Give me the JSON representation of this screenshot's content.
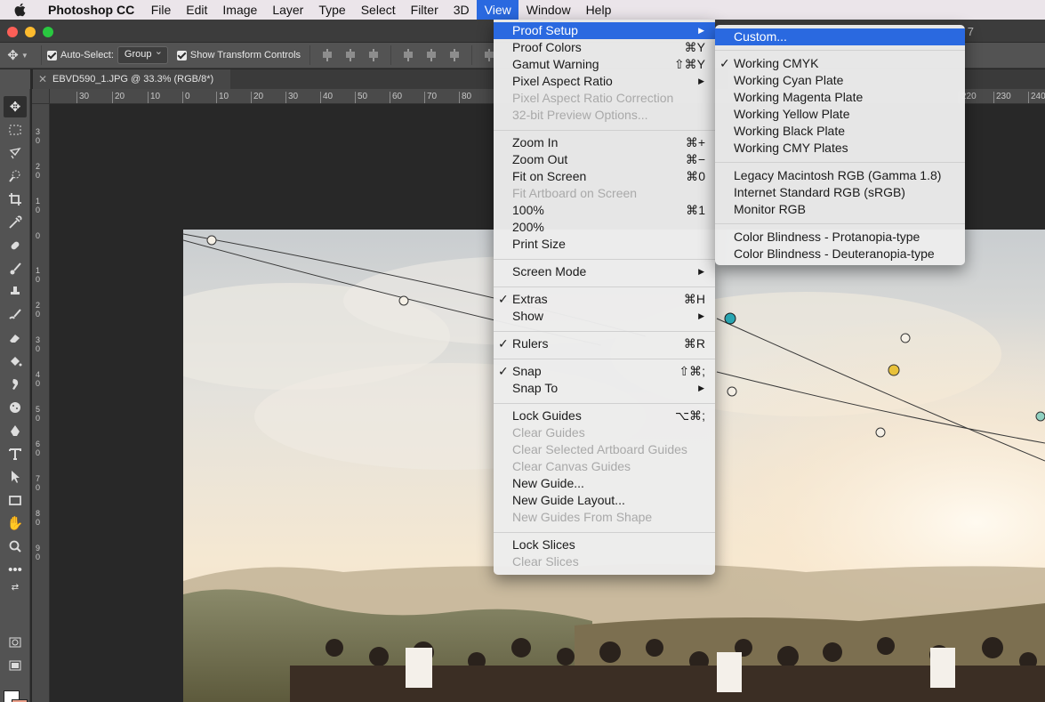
{
  "menubar": {
    "app_name": "Photoshop CC",
    "items": [
      "File",
      "Edit",
      "Image",
      "Layer",
      "Type",
      "Select",
      "Filter",
      "3D",
      "View",
      "Window",
      "Help"
    ],
    "active": "View"
  },
  "title_tail": "7",
  "options": {
    "auto_select_label": "Auto-Select:",
    "auto_select_value": "Group",
    "show_transform_label": "Show Transform Controls"
  },
  "document_tab": "EBVD590_1.JPG @ 33.3% (RGB/8*)",
  "ruler": {
    "top": [
      "30",
      "20",
      "10",
      "0",
      "10",
      "20",
      "30",
      "40",
      "50",
      "60",
      "70",
      "80",
      "220",
      "230",
      "240"
    ],
    "left": [
      "3",
      "0",
      "2",
      "0",
      "1",
      "0",
      "0",
      "1",
      "0",
      "2",
      "0",
      "3",
      "0",
      "4",
      "0",
      "5",
      "0",
      "6",
      "0",
      "7",
      "0",
      "8",
      "0",
      "9",
      "0"
    ]
  },
  "view_menu": {
    "items": [
      {
        "label": "Proof Setup",
        "shortcut": "",
        "submenu": true,
        "highlighted": true
      },
      {
        "label": "Proof Colors",
        "shortcut": "⌘Y"
      },
      {
        "label": "Gamut Warning",
        "shortcut": "⇧⌘Y"
      },
      {
        "label": "Pixel Aspect Ratio",
        "shortcut": "",
        "submenu": true
      },
      {
        "label": "Pixel Aspect Ratio Correction",
        "disabled": true
      },
      {
        "label": "32-bit Preview Options...",
        "disabled": true
      },
      {
        "label": "Zoom In",
        "shortcut": "⌘+"
      },
      {
        "label": "Zoom Out",
        "shortcut": "⌘−"
      },
      {
        "label": "Fit on Screen",
        "shortcut": "⌘0"
      },
      {
        "label": "Fit Artboard on Screen",
        "disabled": true
      },
      {
        "label": "100%",
        "shortcut": "⌘1"
      },
      {
        "label": "200%",
        "shortcut": ""
      },
      {
        "label": "Print Size",
        "shortcut": ""
      },
      {
        "label": "Screen Mode",
        "submenu": true
      },
      {
        "label": "Extras",
        "shortcut": "⌘H",
        "checked": true
      },
      {
        "label": "Show",
        "submenu": true
      },
      {
        "label": "Rulers",
        "shortcut": "⌘R",
        "checked": true
      },
      {
        "label": "Snap",
        "shortcut": "⇧⌘;",
        "checked": true
      },
      {
        "label": "Snap To",
        "submenu": true
      },
      {
        "label": "Lock Guides",
        "shortcut": "⌥⌘;"
      },
      {
        "label": "Clear Guides",
        "disabled": true
      },
      {
        "label": "Clear Selected Artboard Guides",
        "disabled": true
      },
      {
        "label": "Clear Canvas Guides",
        "disabled": true
      },
      {
        "label": "New Guide..."
      },
      {
        "label": "New Guide Layout..."
      },
      {
        "label": "New Guides From Shape",
        "disabled": true
      },
      {
        "label": "Lock Slices"
      },
      {
        "label": "Clear Slices",
        "disabled": true
      }
    ]
  },
  "proof_menu": {
    "items": [
      {
        "label": "Custom...",
        "highlighted": true
      },
      {
        "label": "Working CMYK",
        "checked": true
      },
      {
        "label": "Working Cyan Plate"
      },
      {
        "label": "Working Magenta Plate"
      },
      {
        "label": "Working Yellow Plate"
      },
      {
        "label": "Working Black Plate"
      },
      {
        "label": "Working CMY Plates"
      },
      {
        "label": "Legacy Macintosh RGB (Gamma 1.8)"
      },
      {
        "label": "Internet Standard RGB (sRGB)"
      },
      {
        "label": "Monitor RGB"
      },
      {
        "label": "Color Blindness - Protanopia-type"
      },
      {
        "label": "Color Blindness - Deuteranopia-type"
      }
    ]
  },
  "colors": {
    "menu_highlight": "#2a69e0",
    "foreground_swatch": "#ffffff",
    "background_swatch": "#eaa08a"
  },
  "icons": {
    "apple": "apple-logo-icon",
    "checkmark": "✓",
    "submenu_arrow": "▶"
  }
}
